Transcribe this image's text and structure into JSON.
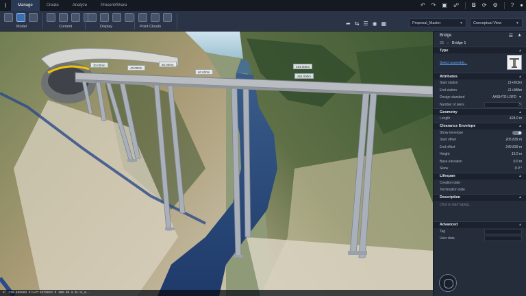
{
  "app": {
    "logo": "I"
  },
  "tabs": [
    "Manage",
    "Create",
    "Analyze",
    "Present/Share"
  ],
  "top_right_icons": [
    "undo-icon",
    "redo-icon",
    "save-icon",
    "share-icon",
    "bold-b-icon",
    "refresh-icon",
    "settings-icon",
    "help-icon",
    "user-icon"
  ],
  "ribbon": {
    "groups": [
      {
        "label": "Model",
        "icons": 3
      },
      {
        "label": "Content",
        "icons": 4
      },
      {
        "label": "Display",
        "icons": 4
      },
      {
        "label": "Point Clouds",
        "icons": 3
      }
    ],
    "proposal": "Proposal_Master",
    "view": "Conceptual View"
  },
  "viewport": {
    "station_labels": [
      "30.000m",
      "40.000m",
      "50.000m",
      "60.000m",
      "454.000m",
      "464.000m"
    ],
    "status": "X: 116.865563  E/LAT:5276624 E  460.90 m  EL:H_m..."
  },
  "panel": {
    "title": "Bridge",
    "crumb_num": "25",
    "crumb_item": "Bridge 1",
    "sections": {
      "type": "Type",
      "attributes": "Attributes",
      "geometry": "Geometry",
      "clearance": "Clearance Envelope",
      "lifespan": "Lifespan",
      "description": "Description",
      "advanced": "Advanced"
    },
    "select_assembly": "Select assembly...",
    "attributes": {
      "start_station_label": "Start station",
      "start_station": "11+563m",
      "end_station_label": "End station",
      "end_station": "11+988m",
      "design_standard_label": "Design standard",
      "design_standard": "AASHTO LRFD",
      "num_piers_label": "Number of piers",
      "num_piers": "3"
    },
    "geometry": {
      "length_label": "Length",
      "length": "424.0 m"
    },
    "clearance": {
      "show_label": "Show envelope",
      "start_offset_label": "Start offset",
      "start_offset": "205.839 m",
      "end_offset_label": "End offset",
      "end_offset": "249.839 m",
      "height_label": "Height",
      "height": "15.0 m",
      "base_elev_label": "Base elevation",
      "base_elev": "0.0 m",
      "skew_label": "Skew",
      "skew": "0.0 °"
    },
    "lifespan": {
      "creation_label": "Creation date",
      "termination_label": "Termination date"
    },
    "description_placeholder": "Click to start typing...",
    "advanced": {
      "tag_label": "Tag",
      "user_data_label": "User data"
    }
  }
}
